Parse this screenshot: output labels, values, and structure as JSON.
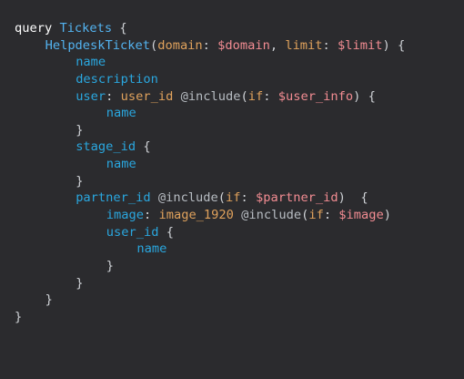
{
  "editor": {
    "colors": {
      "background": "#2b2b2e",
      "plain": "#cfd2d6",
      "keyword": "#ffffff",
      "name": "#53b3f0",
      "field": "#2aa7df",
      "argument": "#e0a25c",
      "variable": "#f28c92",
      "directive": "#b7bcc2"
    },
    "lines": [
      {
        "indent": 0,
        "tokens": [
          [
            "keyword",
            "query"
          ],
          [
            "plain",
            " "
          ],
          [
            "name",
            "Tickets"
          ],
          [
            "plain",
            " {"
          ]
        ]
      },
      {
        "indent": 1,
        "tokens": [
          [
            "name",
            "HelpdeskTicket"
          ],
          [
            "plain",
            "("
          ],
          [
            "arg",
            "domain"
          ],
          [
            "plain",
            ": "
          ],
          [
            "var",
            "$domain"
          ],
          [
            "plain",
            ", "
          ],
          [
            "arg",
            "limit"
          ],
          [
            "plain",
            ": "
          ],
          [
            "var",
            "$limit"
          ],
          [
            "plain",
            ") {"
          ]
        ]
      },
      {
        "indent": 2,
        "tokens": [
          [
            "field",
            "name"
          ]
        ]
      },
      {
        "indent": 2,
        "tokens": [
          [
            "field",
            "description"
          ]
        ]
      },
      {
        "indent": 2,
        "tokens": [
          [
            "field",
            "user"
          ],
          [
            "plain",
            ": "
          ],
          [
            "arg",
            "user_id"
          ],
          [
            "plain",
            " "
          ],
          [
            "dir",
            "@include"
          ],
          [
            "plain",
            "("
          ],
          [
            "arg",
            "if"
          ],
          [
            "plain",
            ": "
          ],
          [
            "var",
            "$user_info"
          ],
          [
            "plain",
            ") {"
          ]
        ]
      },
      {
        "indent": 3,
        "tokens": [
          [
            "field",
            "name"
          ]
        ]
      },
      {
        "indent": 2,
        "tokens": [
          [
            "plain",
            "}"
          ]
        ]
      },
      {
        "indent": 2,
        "tokens": [
          [
            "field",
            "stage_id"
          ],
          [
            "plain",
            " {"
          ]
        ]
      },
      {
        "indent": 3,
        "tokens": [
          [
            "field",
            "name"
          ]
        ]
      },
      {
        "indent": 2,
        "tokens": [
          [
            "plain",
            "}"
          ]
        ]
      },
      {
        "indent": 2,
        "tokens": [
          [
            "field",
            "partner_id"
          ],
          [
            "plain",
            " "
          ],
          [
            "dir",
            "@include"
          ],
          [
            "plain",
            "("
          ],
          [
            "arg",
            "if"
          ],
          [
            "plain",
            ": "
          ],
          [
            "var",
            "$partner_id"
          ],
          [
            "plain",
            ")  {"
          ]
        ]
      },
      {
        "indent": 3,
        "tokens": [
          [
            "field",
            "image"
          ],
          [
            "plain",
            ": "
          ],
          [
            "arg",
            "image_1920"
          ],
          [
            "plain",
            " "
          ],
          [
            "dir",
            "@include"
          ],
          [
            "plain",
            "("
          ],
          [
            "arg",
            "if"
          ],
          [
            "plain",
            ": "
          ],
          [
            "var",
            "$image"
          ],
          [
            "plain",
            ")"
          ]
        ]
      },
      {
        "indent": 3,
        "tokens": [
          [
            "field",
            "user_id"
          ],
          [
            "plain",
            " {"
          ]
        ]
      },
      {
        "indent": 4,
        "tokens": [
          [
            "field",
            "name"
          ]
        ]
      },
      {
        "indent": 3,
        "tokens": [
          [
            "plain",
            "}"
          ]
        ]
      },
      {
        "indent": 2,
        "tokens": [
          [
            "plain",
            "}"
          ]
        ]
      },
      {
        "indent": 1,
        "tokens": [
          [
            "plain",
            "}"
          ]
        ]
      },
      {
        "indent": 0,
        "tokens": [
          [
            "plain",
            "}"
          ]
        ]
      }
    ]
  }
}
